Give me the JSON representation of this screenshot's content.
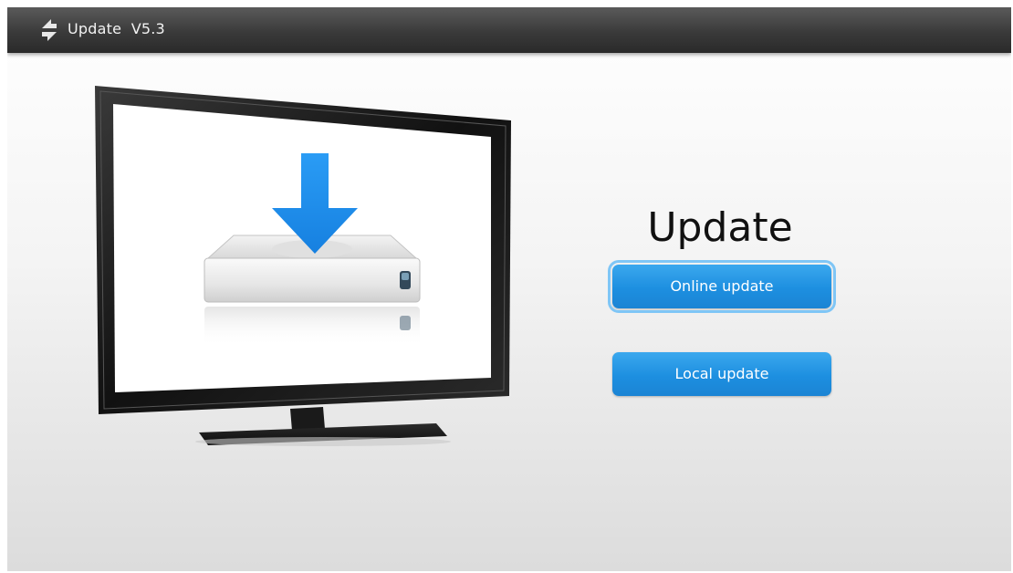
{
  "title_bar": {
    "icon": "sync-arrows-icon",
    "title": "Update  V5.3"
  },
  "illustration": {
    "icon": "tv-download-drive-icon"
  },
  "main": {
    "heading": "Update",
    "buttons": [
      {
        "label": "Online update",
        "focused": true
      },
      {
        "label": "Local update",
        "focused": false
      }
    ]
  },
  "colors": {
    "title_bar": "#3a3a3a",
    "button_blue": "#1d8fe0",
    "focus_ring": "#7fc6f6",
    "arrow_blue": "#1e90f0"
  }
}
